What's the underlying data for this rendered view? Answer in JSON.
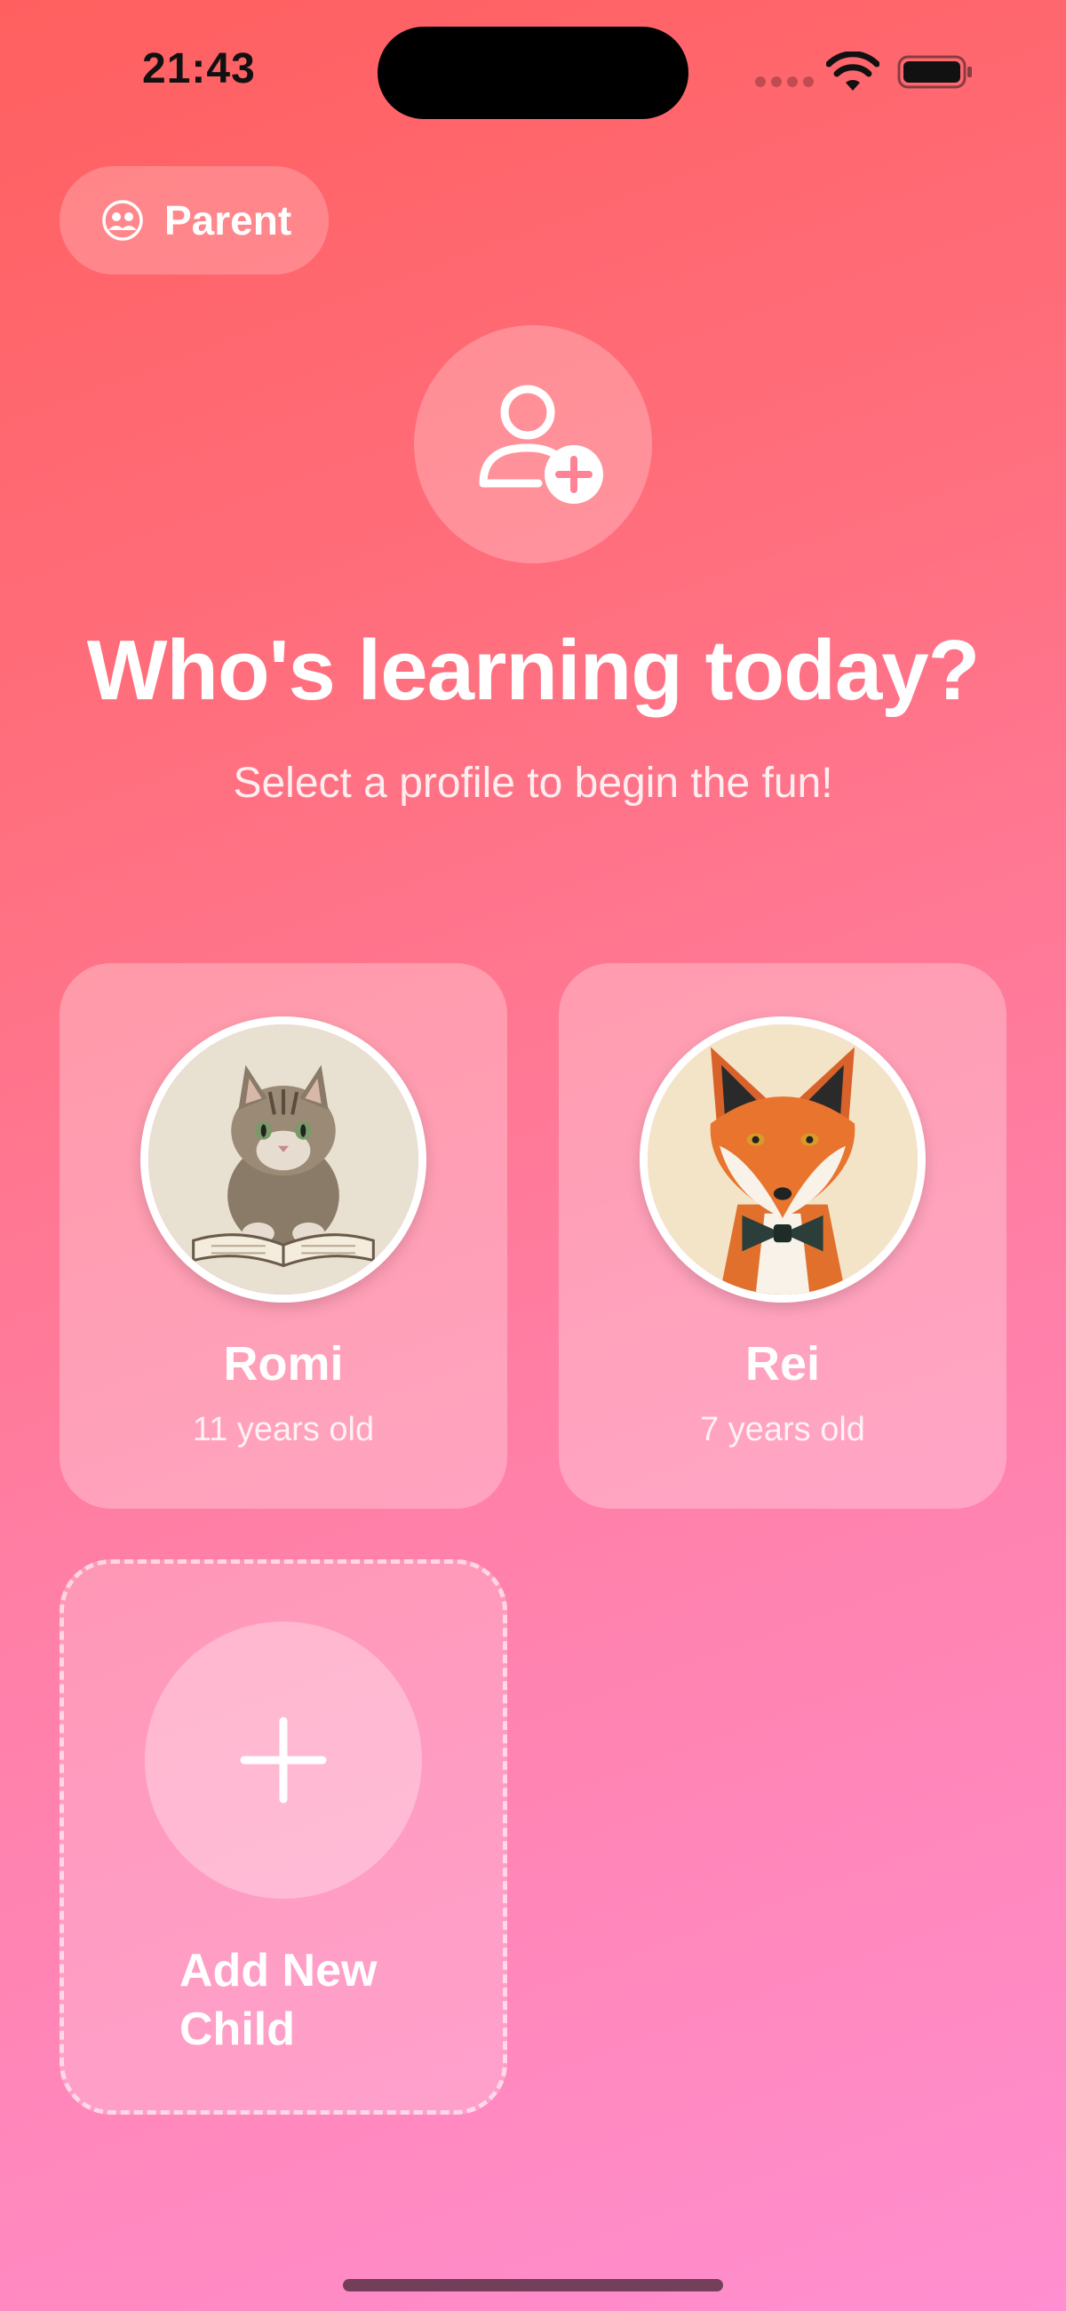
{
  "status_bar": {
    "time": "21:43"
  },
  "parent_button": {
    "label": "Parent"
  },
  "header": {
    "title": "Who's learning today?",
    "subtitle": "Select a profile to begin the fun!"
  },
  "profiles": [
    {
      "name": "Romi",
      "age": "11 years old",
      "avatar_icon": "cat-reading-book-avatar"
    },
    {
      "name": "Rei",
      "age": "7 years old",
      "avatar_icon": "fox-bowtie-avatar"
    }
  ],
  "add_child": {
    "label": "Add New Child",
    "icon": "plus-icon"
  },
  "colors": {
    "gradient_top": "#ff5f5f",
    "gradient_bottom": "#ff8fd0",
    "text": "#ffffff"
  }
}
